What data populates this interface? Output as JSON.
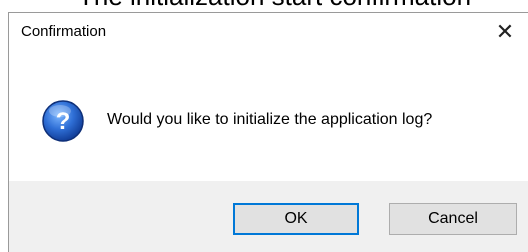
{
  "caption_fragment": "The initialization start confirmation",
  "dialog": {
    "title": "Confirmation",
    "close_glyph": "✕",
    "icon": "question-icon",
    "message": "Would you like to initialize the application log?",
    "buttons": {
      "ok_label": "OK",
      "cancel_label": "Cancel"
    }
  },
  "colors": {
    "accent": "#0078d7",
    "footer_bg": "#f0f0f0",
    "button_bg": "#e1e1e1"
  }
}
